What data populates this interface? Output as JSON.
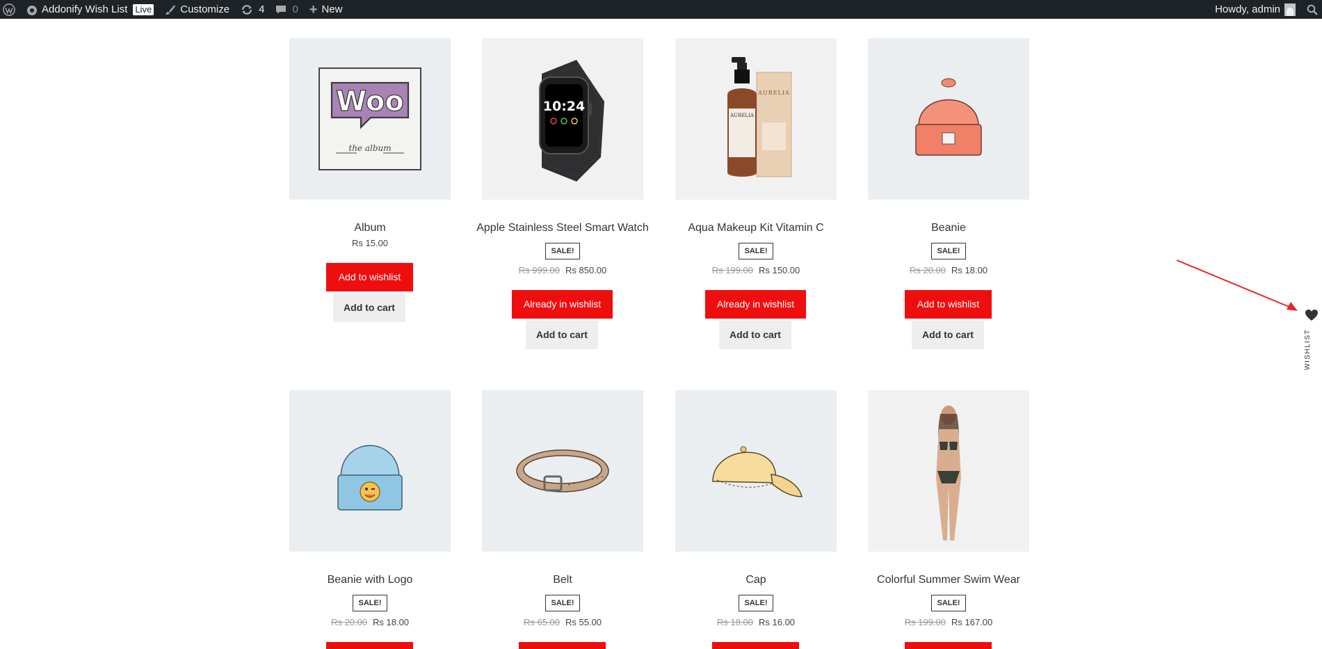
{
  "adminbar": {
    "site_name": "Addonify Wish List",
    "live_badge": "Live",
    "customize": "Customize",
    "updates_count": "4",
    "comments_count": "0",
    "new": "New",
    "greeting": "Howdy, admin"
  },
  "products": [
    {
      "name": "Album",
      "sale_badge": "",
      "old_price": "",
      "price": "Rs 15.00",
      "wishlist_label": "Add to wishlist",
      "cart_label": "Add to cart"
    },
    {
      "name": "Apple Stainless Steel Smart Watch",
      "sale_badge": "SALE!",
      "old_price": "Rs 999.00",
      "price": "Rs 850.00",
      "wishlist_label": "Already in wishlist",
      "cart_label": "Add to cart"
    },
    {
      "name": "Aqua Makeup Kit Vitamin C",
      "sale_badge": "SALE!",
      "old_price": "Rs 199.00",
      "price": "Rs 150.00",
      "wishlist_label": "Already in wishlist",
      "cart_label": "Add to cart"
    },
    {
      "name": "Beanie",
      "sale_badge": "SALE!",
      "old_price": "Rs 20.00",
      "price": "Rs 18.00",
      "wishlist_label": "Add to wishlist",
      "cart_label": "Add to cart"
    },
    {
      "name": "Beanie with Logo",
      "sale_badge": "SALE!",
      "old_price": "Rs 20.00",
      "price": "Rs 18.00"
    },
    {
      "name": "Belt",
      "sale_badge": "SALE!",
      "old_price": "Rs 65.00",
      "price": "Rs 55.00"
    },
    {
      "name": "Cap",
      "sale_badge": "SALE!",
      "old_price": "Rs 18.00",
      "price": "Rs 16.00"
    },
    {
      "name": "Colorful Summer Swim Wear",
      "sale_badge": "SALE!",
      "old_price": "Rs 199.00",
      "price": "Rs 167.00"
    }
  ],
  "album_art": {
    "logo_text": "Woo",
    "caption": "the album"
  },
  "watch_face": {
    "time": "10:24"
  },
  "bottle_brand": "AURELIA",
  "wishlist_sidebar": {
    "label": "WISHLIST"
  },
  "colors": {
    "primary_button": "#ef0e0e",
    "admin_bar": "#1d2327"
  }
}
